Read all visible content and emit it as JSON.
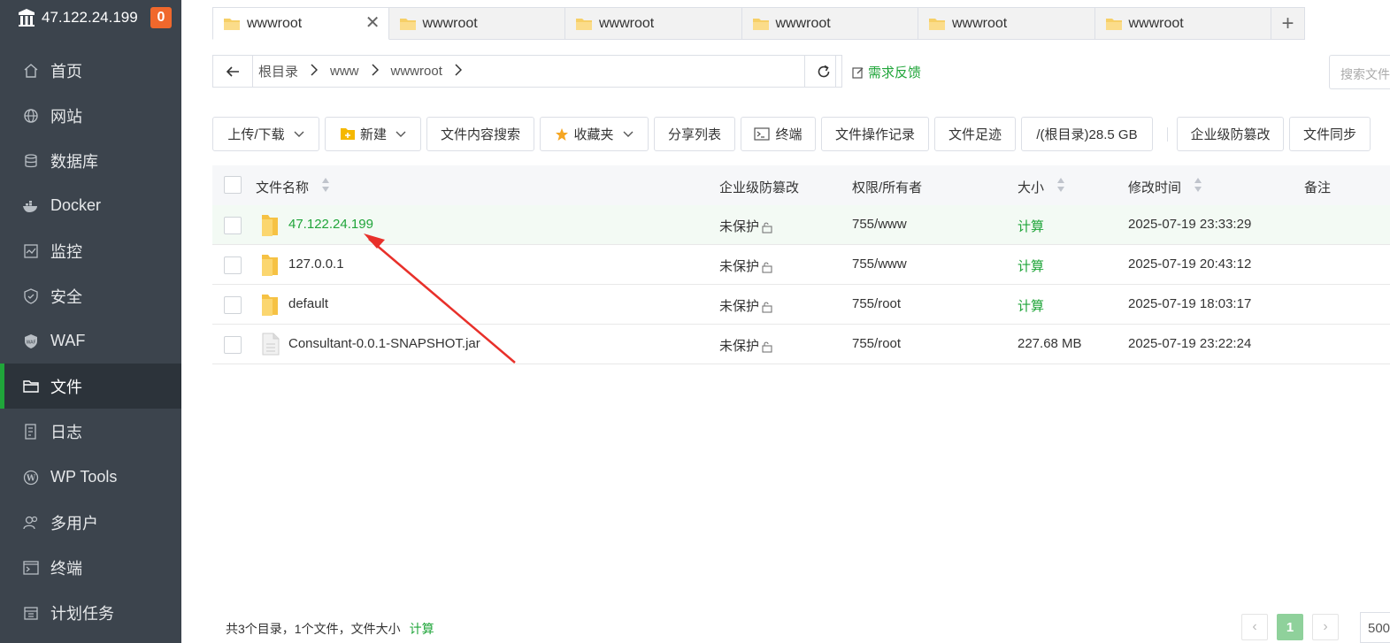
{
  "sidebar": {
    "server_ip": "47.122.24.199",
    "badge": "0",
    "items": [
      {
        "label": "首页",
        "icon": "home-icon"
      },
      {
        "label": "网站",
        "icon": "globe-icon"
      },
      {
        "label": "数据库",
        "icon": "database-icon"
      },
      {
        "label": "Docker",
        "icon": "docker-icon"
      },
      {
        "label": "监控",
        "icon": "monitor-icon"
      },
      {
        "label": "安全",
        "icon": "shield-icon"
      },
      {
        "label": "WAF",
        "icon": "waf-icon"
      },
      {
        "label": "文件",
        "icon": "folder-icon",
        "active": true
      },
      {
        "label": "日志",
        "icon": "log-icon"
      },
      {
        "label": "WP Tools",
        "icon": "wordpress-icon"
      },
      {
        "label": "多用户",
        "icon": "users-icon"
      },
      {
        "label": "终端",
        "icon": "terminal-icon"
      },
      {
        "label": "计划任务",
        "icon": "calendar-icon"
      }
    ]
  },
  "tabs": [
    "wwwroot",
    "wwwroot",
    "wwwroot",
    "wwwroot",
    "wwwroot",
    "wwwroot"
  ],
  "path": {
    "crumbs": [
      "根目录",
      "www",
      "wwwroot"
    ],
    "feedback": "需求反馈",
    "search_placeholder": "搜索文件"
  },
  "toolbar": {
    "upload": "上传/下载",
    "new": "新建",
    "content_search": "文件内容搜索",
    "favorites": "收藏夹",
    "share_list": "分享列表",
    "terminal": "终端",
    "op_log": "文件操作记录",
    "footprint": "文件足迹",
    "disk": "/(根目录)28.5 GB",
    "tamper": "企业级防篡改",
    "sync": "文件同步"
  },
  "table": {
    "headers": {
      "name": "文件名称",
      "tamper": "企业级防篡改",
      "perm": "权限/所有者",
      "size": "大小",
      "mtime": "修改时间",
      "note": "备注"
    },
    "rows": [
      {
        "name": "47.122.24.199",
        "type": "folder",
        "tamper": "未保护",
        "perm": "755/www",
        "size": "计算",
        "mtime": "2025-07-19 23:33:29"
      },
      {
        "name": "127.0.0.1",
        "type": "folder",
        "tamper": "未保护",
        "perm": "755/www",
        "size": "计算",
        "mtime": "2025-07-19 20:43:12"
      },
      {
        "name": "default",
        "type": "folder",
        "tamper": "未保护",
        "perm": "755/root",
        "size": "计算",
        "mtime": "2025-07-19 18:03:17"
      },
      {
        "name": "Consultant-0.0.1-SNAPSHOT.jar",
        "type": "file",
        "tamper": "未保护",
        "perm": "755/root",
        "size": "227.68 MB",
        "mtime": "2025-07-19 23:22:24"
      }
    ]
  },
  "footer": {
    "summary": "共3个目录，1个文件，文件大小",
    "calc": "计算",
    "page": "1",
    "page_size": "500"
  },
  "colors": {
    "sidebar_bg": "#3c444d",
    "accent": "#20a53a",
    "badge": "#f0682c",
    "annotation_arrow": "#e8302a"
  }
}
